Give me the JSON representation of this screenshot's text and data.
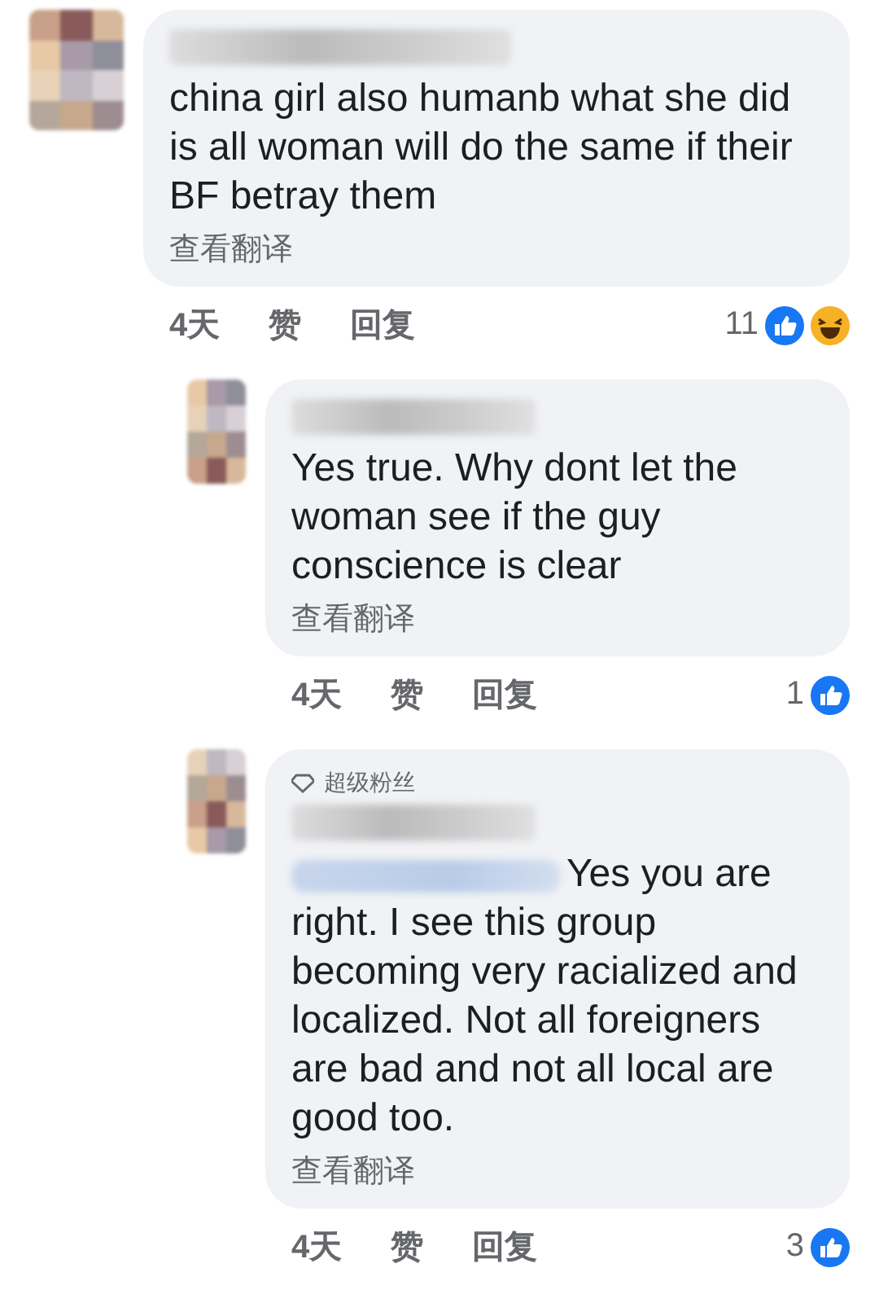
{
  "comments": [
    {
      "text": "china girl also humanb what she did is all woman will do the same if their BF betray them",
      "translate": "查看翻译",
      "time": "4天",
      "like": "赞",
      "reply": "回复",
      "reaction_count": "11",
      "reactions": [
        {
          "kind": "like"
        },
        {
          "kind": "haha"
        }
      ],
      "children": [
        {
          "text": "Yes true. Why dont let the woman see if the guy conscience is clear",
          "translate": "查看翻译",
          "time": "4天",
          "like": "赞",
          "reply": "回复",
          "reaction_count": "1",
          "reactions": [
            {
              "kind": "like"
            }
          ]
        },
        {
          "badge": "超级粉丝",
          "mention": true,
          "text": "Yes you are right. I see this group becoming very racialized and localized. Not all foreigners are bad and not all local are good too.",
          "translate": "查看翻译",
          "time": "4天",
          "like": "赞",
          "reply": "回复",
          "reaction_count": "3",
          "reactions": [
            {
              "kind": "like"
            }
          ]
        }
      ]
    }
  ]
}
